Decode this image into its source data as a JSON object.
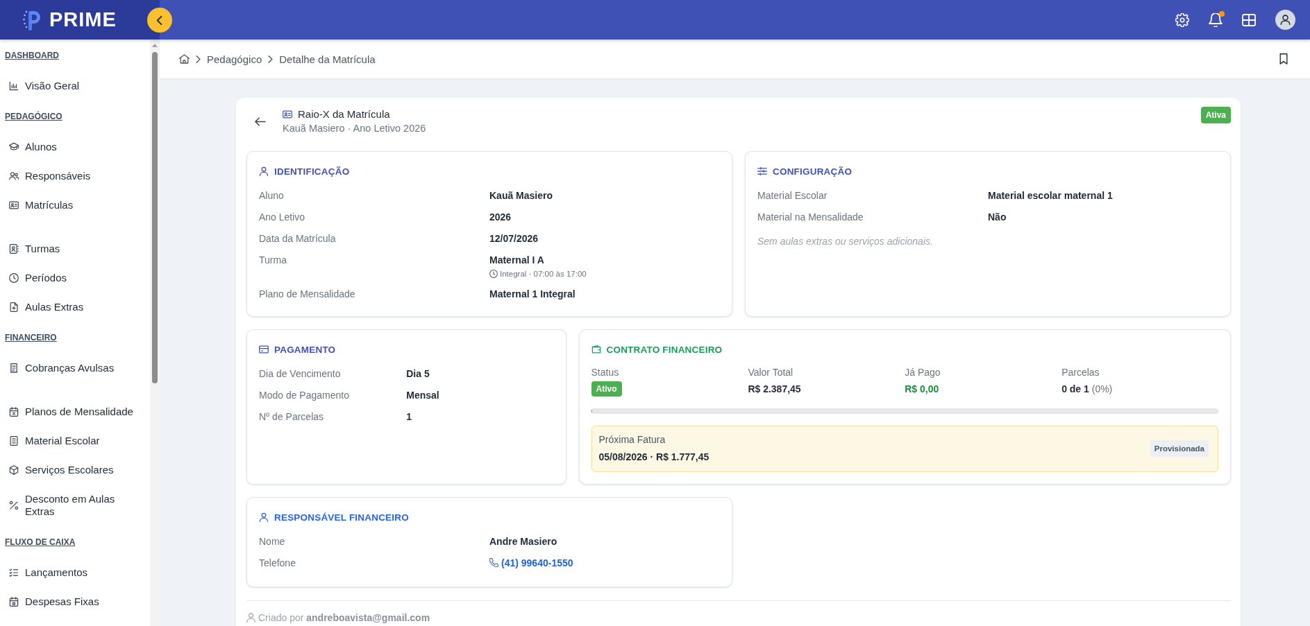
{
  "topbar": {
    "brand": "PRIME",
    "notifications_unread": true
  },
  "sidebar": {
    "sections": [
      {
        "title": "DASHBOARD",
        "groups": [
          {
            "items": [
              {
                "label": "Visão Geral",
                "selected": false
              }
            ]
          }
        ]
      },
      {
        "title": "PEDAGÓGICO",
        "groups": [
          {
            "items": [
              {
                "label": "Alunos",
                "selected": false
              },
              {
                "label": "Responsáveis",
                "selected": false
              },
              {
                "label": "Matrículas",
                "selected": false
              }
            ]
          },
          {
            "items": [
              {
                "label": "Turmas",
                "selected": false
              },
              {
                "label": "Períodos",
                "selected": false
              },
              {
                "label": "Aulas Extras",
                "selected": false
              }
            ]
          }
        ]
      },
      {
        "title": "FINANCEIRO",
        "groups": [
          {
            "items": [
              {
                "label": "Cobranças Avulsas",
                "selected": false
              }
            ]
          },
          {
            "items": [
              {
                "label": "Planos de Mensalidade",
                "selected": false
              },
              {
                "label": "Material Escolar",
                "selected": false
              },
              {
                "label": "Serviços Escolares",
                "selected": false
              },
              {
                "label": "Desconto em Aulas Extras",
                "selected": false
              }
            ]
          }
        ]
      },
      {
        "title": "FLUXO DE CAIXA",
        "groups": [
          {
            "items": [
              {
                "label": "Lançamentos",
                "selected": false
              },
              {
                "label": "Despesas Fixas",
                "selected": false
              }
            ]
          }
        ]
      }
    ]
  },
  "breadcrumb": [
    {
      "label": "Pedagógico"
    },
    {
      "label": "Detalhe da Matrícula"
    }
  ],
  "page": {
    "title": "Raio-X da Matrícula",
    "subtitle": "Kauã Masiero · Ano Letivo 2026",
    "status": "Ativa"
  },
  "rows": [
    {
      "cards": [
        {
          "kind": "fields",
          "title": "IDENTIFICAÇÃO",
          "color": "#3f51b5",
          "fields": [
            {
              "kind": "text",
              "label": "Aluno",
              "value": "Kauã Masiero"
            },
            {
              "kind": "text",
              "label": "Ano Letivo",
              "value": "2026"
            },
            {
              "kind": "text",
              "label": "Data da Matrícula",
              "value": "12/07/2026"
            },
            {
              "kind": "text",
              "label": "Turma",
              "value": "Maternal I A",
              "detail": "Integral · 07:00 às 17:00"
            },
            {
              "kind": "text",
              "label": "Plano de Mensalidade",
              "value": "Maternal 1 Integral"
            }
          ]
        },
        {
          "kind": "fields",
          "title": "CONFIGURAÇÃO",
          "color": "#3f51b5",
          "fields": [
            {
              "kind": "text",
              "label": "Material Escolar",
              "value": "Material escolar maternal 1"
            },
            {
              "kind": "text",
              "label": "Material na Mensalidade",
              "value": "Não"
            }
          ],
          "note": "Sem aulas extras ou serviços adicionais."
        }
      ]
    },
    {
      "cards": [
        {
          "kind": "fields",
          "title": "PAGAMENTO",
          "color": "#3f51b5",
          "fields": [
            {
              "kind": "text",
              "label": "Dia de Vencimento",
              "value": "Dia 5"
            },
            {
              "kind": "text",
              "label": "Modo de Pagamento",
              "value": "Mensal"
            },
            {
              "kind": "text",
              "label": "Nº de Parcelas",
              "value": "1"
            }
          ]
        },
        {
          "kind": "contract",
          "title": "CONTRATO FINANCEIRO",
          "color": "#1e9a5c",
          "stats": [
            {
              "kind": "badge",
              "label": "Status",
              "value": "Ativo"
            },
            {
              "kind": "total",
              "label": "Valor Total",
              "value": "R$ 2.387,45"
            },
            {
              "kind": "paid",
              "label": "Já Pago",
              "value": "R$ 0,00"
            },
            {
              "kind": "count",
              "label": "Parcelas",
              "value": "**0 de 1** (0%)"
            }
          ],
          "progress": {
            "level": 0
          },
          "invoice": {
            "label": "Próxima Fatura",
            "value": "05/08/2026 · R$ 1.777,45",
            "status": "Provisionada"
          }
        }
      ]
    },
    {
      "cards": [
        {
          "kind": "fields",
          "title": "RESPONSÁVEL FINANCEIRO",
          "color": "#2563eb",
          "fields": [
            {
              "kind": "text",
              "label": "Nome",
              "value": "Andre Masiero"
            },
            {
              "kind": "phone",
              "label": "Telefone",
              "value": "(41) 99640-1550"
            }
          ]
        }
      ]
    }
  ],
  "footer": {
    "created_by": "Criado por **andreboavista@gmail.com**"
  }
}
